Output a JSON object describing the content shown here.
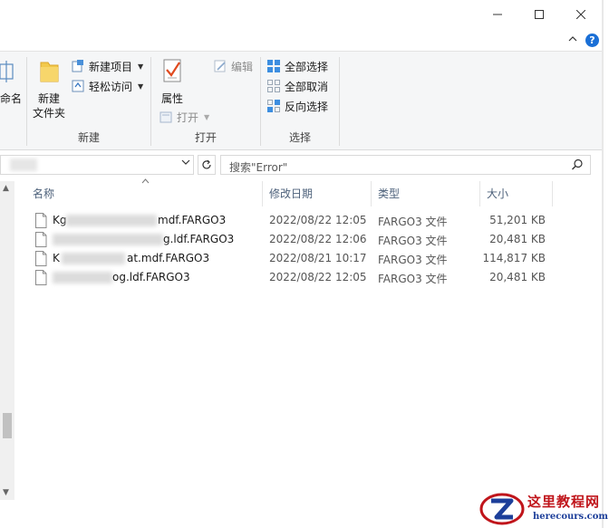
{
  "ribbon": {
    "rename_partial": "命名",
    "new_group": {
      "label": "新建",
      "new_folder": "新建\n文件夹",
      "new_item": "新建项目",
      "easy_access": "轻松访问"
    },
    "open_group": {
      "label": "打开",
      "properties": "属性",
      "open": "打开",
      "edit": "编辑"
    },
    "select_group": {
      "label": "选择",
      "select_all": "全部选择",
      "select_none": "全部取消",
      "invert": "反向选择"
    }
  },
  "search": {
    "placeholder": "搜索\"Error\""
  },
  "columns": {
    "name": "名称",
    "modified": "修改日期",
    "type": "类型",
    "size": "大小"
  },
  "files": [
    {
      "name": "Kgt...mdf.FARGO3",
      "visible_suffix": "mdf.FARGO3",
      "modified": "2022/08/22 12:05",
      "type": "FARGO3 文件",
      "size": "51,201 KB"
    },
    {
      "name": "...ldf.FARGO3",
      "visible_suffix": "g.ldf.FARGO3",
      "modified": "2022/08/22 12:06",
      "type": "FARGO3 文件",
      "size": "20,481 KB"
    },
    {
      "name": "K...at.mdf.FARGO3",
      "visible_suffix": "at.mdf.FARGO3",
      "modified": "2022/08/21 10:17",
      "type": "FARGO3 文件",
      "size": "114,817 KB"
    },
    {
      "name": "...og.ldf.FARGO3",
      "visible_suffix": "og.ldf.FARGO3",
      "modified": "2022/08/22 12:05",
      "type": "FARGO3 文件",
      "size": "20,481 KB"
    }
  ],
  "watermark": {
    "title": "这里教程网",
    "url": "herecours.com"
  },
  "colors": {
    "accent": "#1a6fd6",
    "header_text": "#4c607a",
    "watermark_red": "#c0151b",
    "watermark_blue": "#1d3f9a"
  }
}
